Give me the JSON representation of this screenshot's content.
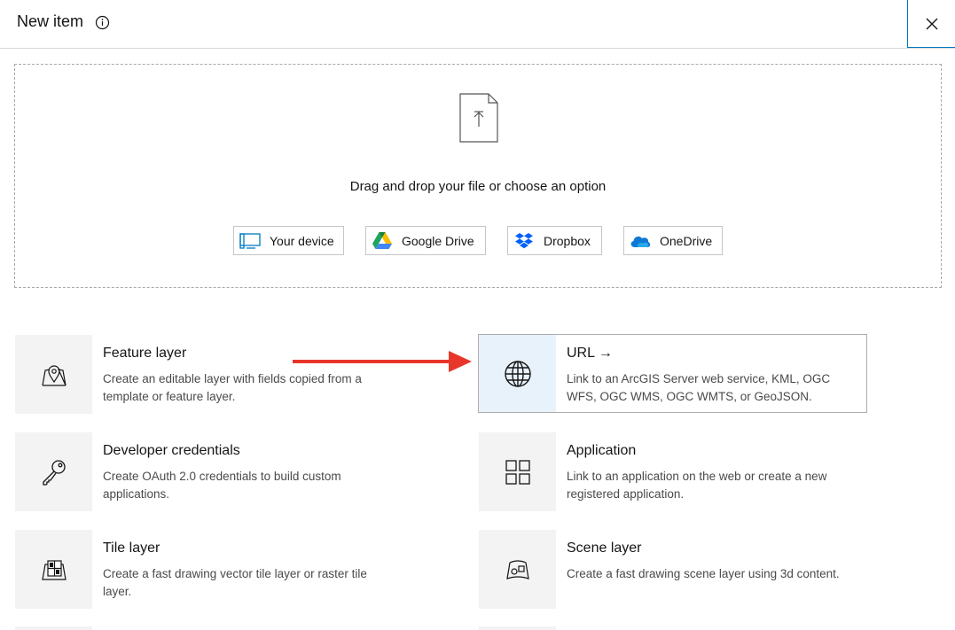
{
  "header": {
    "title": "New item",
    "info_icon": "info-icon",
    "close_icon": "close-icon"
  },
  "dropzone": {
    "instruction": "Drag and drop your file or choose an option",
    "sources": [
      {
        "label": "Your device",
        "icon": "device-icon"
      },
      {
        "label": "Google Drive",
        "icon": "google-drive-icon"
      },
      {
        "label": "Dropbox",
        "icon": "dropbox-icon"
      },
      {
        "label": "OneDrive",
        "icon": "onedrive-icon"
      }
    ]
  },
  "items": [
    {
      "title": "Feature layer",
      "description": "Create an editable layer with fields copied from a template or feature layer.",
      "icon": "map-pin-icon"
    },
    {
      "title": "URL →",
      "description": "Link to an ArcGIS Server web service, KML, OGC WFS, OGC WMS, OGC WMTS, or GeoJSON.",
      "icon": "globe-icon",
      "selected": true
    },
    {
      "title": "Developer credentials",
      "description": "Create OAuth 2.0 credentials to build custom applications.",
      "icon": "key-icon"
    },
    {
      "title": "Application",
      "description": "Link to an application on the web or create a new registered application.",
      "icon": "grid-icon"
    },
    {
      "title": "Tile layer",
      "description": "Create a fast drawing vector tile layer or raster tile layer.",
      "icon": "tile-layer-icon"
    },
    {
      "title": "Scene layer",
      "description": "Create a fast drawing scene layer using 3d content.",
      "icon": "scene-layer-icon"
    }
  ],
  "colors": {
    "accent": "#0079c1",
    "annotation_arrow": "#e8372a",
    "selected_bg": "#e8f2fb"
  }
}
